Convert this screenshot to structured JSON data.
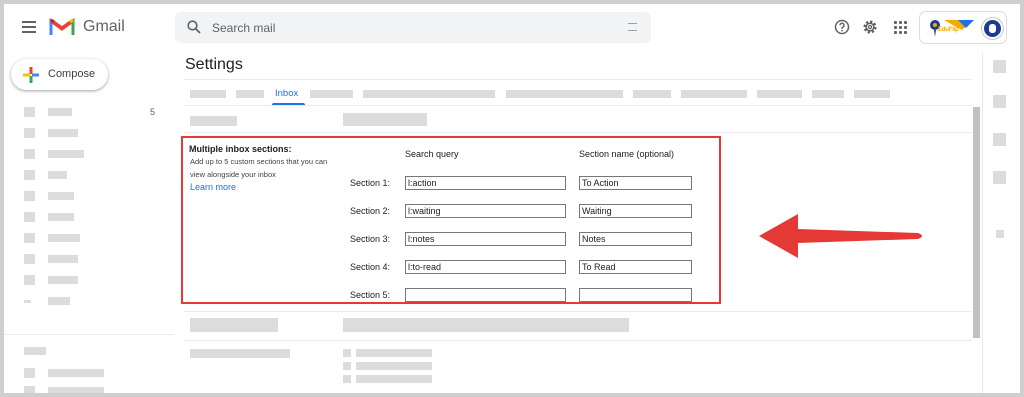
{
  "header": {
    "brand": "Gmail",
    "search_placeholder": "Search mail",
    "account_logo_text": "EduFlip"
  },
  "sidebar": {
    "compose_label": "Compose",
    "first_item_count": "5"
  },
  "main": {
    "title": "Settings",
    "active_tab": "Inbox",
    "multiple_inbox": {
      "title": "Multiple inbox sections:",
      "description": "Add up to 5 custom sections that you can view alongside your inbox",
      "learn_more": "Learn more",
      "col_search_query": "Search query",
      "col_section_name": "Section name (optional)",
      "sections": [
        {
          "label": "Section 1:",
          "query": "l:action",
          "name": "To Action"
        },
        {
          "label": "Section 2:",
          "query": "l:waiting",
          "name": "Waiting"
        },
        {
          "label": "Section 3:",
          "query": "l:notes",
          "name": "Notes"
        },
        {
          "label": "Section 4:",
          "query": "l:to-read",
          "name": "To Read"
        },
        {
          "label": "Section 5:",
          "query": "",
          "name": ""
        }
      ]
    }
  },
  "colors": {
    "accent": "#1a73e8",
    "highlight_border": "#e53935",
    "arrow": "#e53935"
  }
}
